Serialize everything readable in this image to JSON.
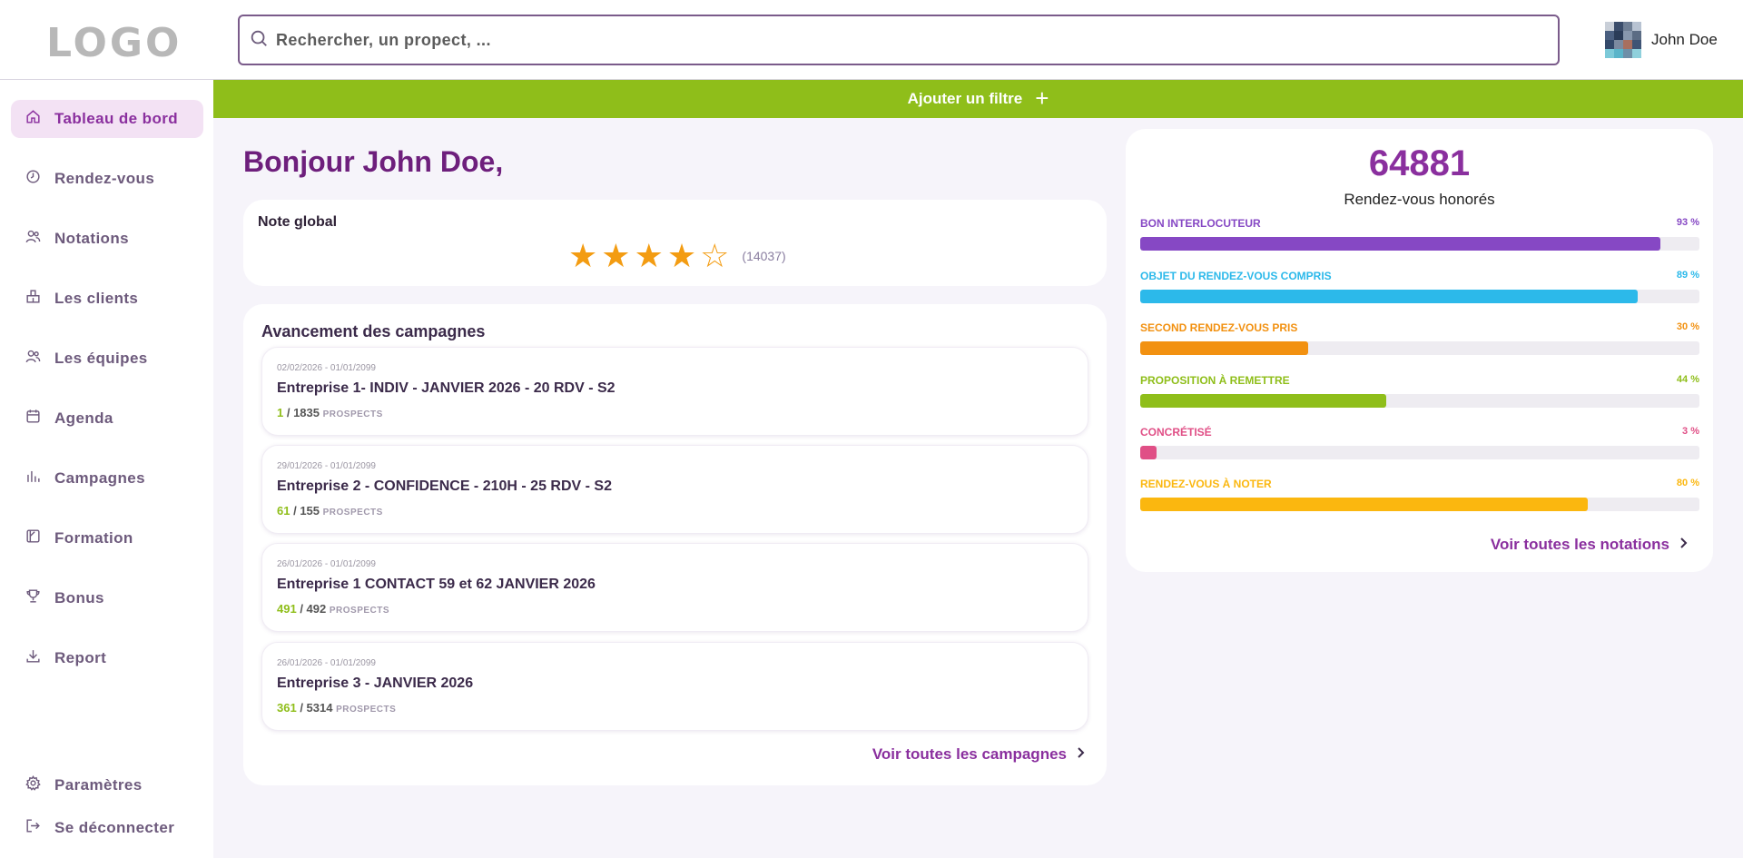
{
  "app": {
    "logo_text": "LOGO",
    "search_placeholder": "Rechercher, un propect, ...",
    "user_name": "John Doe"
  },
  "sidebar": {
    "items": [
      {
        "label": "Tableau de bord",
        "icon": "home-icon",
        "active": true
      },
      {
        "label": "Rendez-vous",
        "icon": "clock-icon"
      },
      {
        "label": "Notations",
        "icon": "users-icon"
      },
      {
        "label": "Les clients",
        "icon": "building-icon"
      },
      {
        "label": "Les équipes",
        "icon": "team-icon"
      },
      {
        "label": "Agenda",
        "icon": "calendar-icon"
      },
      {
        "label": "Campagnes",
        "icon": "bar-chart-icon"
      },
      {
        "label": "Formation",
        "icon": "book-icon"
      },
      {
        "label": "Bonus",
        "icon": "trophy-icon"
      },
      {
        "label": "Report",
        "icon": "download-icon"
      }
    ],
    "bottom": [
      {
        "label": "Paramètres",
        "icon": "gear-icon"
      },
      {
        "label": "Se déconnecter",
        "icon": "logout-icon"
      }
    ]
  },
  "filter_bar": {
    "label": "Ajouter un filtre",
    "plus": "+"
  },
  "greeting": "Bonjour John Doe,",
  "rating": {
    "title": "Note global",
    "stars": 4,
    "max": 5,
    "count": "(14037)"
  },
  "campaigns": {
    "title": "Avancement des campagnes",
    "prospects_label": "PROSPECTS",
    "items": [
      {
        "dates": "02/02/2026 - 01/01/2099",
        "name": "Entreprise 1- INDIV - JANVIER 2026 - 20 RDV - S2",
        "done": "1",
        "total": "1835"
      },
      {
        "dates": "29/01/2026 - 01/01/2099",
        "name": "Entreprise 2 - CONFIDENCE - 210H - 25 RDV - S2",
        "done": "61",
        "total": "155"
      },
      {
        "dates": "26/01/2026 - 01/01/2099",
        "name": "Entreprise 1 CONTACT 59 et 62 JANVIER 2026",
        "done": "491",
        "total": "492"
      },
      {
        "dates": "26/01/2026 - 01/01/2099",
        "name": "Entreprise 3 - JANVIER 2026",
        "done": "361",
        "total": "5314"
      }
    ],
    "link": "Voir toutes les campagnes"
  },
  "stats": {
    "total": "64881",
    "total_label": "Rendez-vous honorés",
    "items": [
      {
        "label": "BON INTERLOCUTEUR",
        "value": 93,
        "pct": "93 %",
        "color": "#8648c4"
      },
      {
        "label": "OBJET DU RENDEZ-VOUS COMPRIS",
        "value": 89,
        "pct": "89 %",
        "color": "#2cb9ea"
      },
      {
        "label": "SECOND RENDEZ-VOUS PRIS",
        "value": 30,
        "pct": "30 %",
        "color": "#f29111"
      },
      {
        "label": "PROPOSITION À REMETTRE",
        "value": 44,
        "pct": "44 %",
        "color": "#8fbe1a"
      },
      {
        "label": "CONCRÉTISÉ",
        "value": 3,
        "pct": "3 %",
        "color": "#e04f86"
      },
      {
        "label": "RENDEZ-VOUS À NOTER",
        "value": 80,
        "pct": "80 %",
        "color": "#fbb70f"
      }
    ],
    "link": "Voir toutes les notations"
  },
  "colors": {
    "accent": "#8a2f9e",
    "filter_bar": "#8fbe1a",
    "star": "#f39c12",
    "greeting": "#6e1f7c"
  }
}
